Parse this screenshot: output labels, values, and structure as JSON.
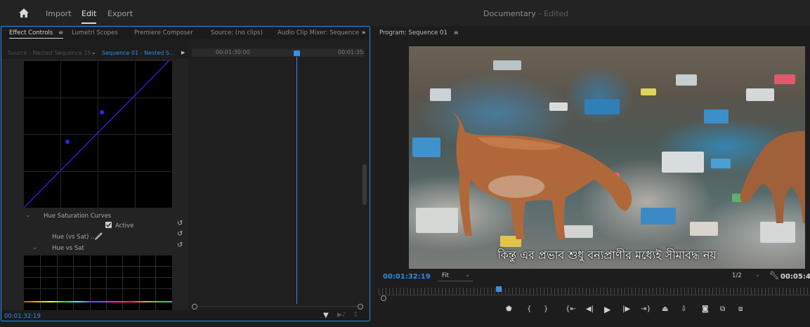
{
  "topbar": {
    "nav": [
      "Import",
      "Edit",
      "Export"
    ],
    "active_nav": "Edit",
    "doc_title": "Documentary",
    "doc_status": "- Edited"
  },
  "left_panel": {
    "tabs": [
      "Effect Controls",
      "Lumetri Scopes",
      "Premiere Composer",
      "Source: (no clips)",
      "Audio Clip Mixer: Sequence"
    ],
    "active_tab": "Effect Controls",
    "source_label": "Source - Nested Sequence 15",
    "sequence_select": "Sequence 01 - Nested S...",
    "ruler_times": [
      "00:01:30:00",
      "00:01:35:"
    ],
    "sections": {
      "hue_sat_curves": "Hue Saturation Curves",
      "active_label": "Active",
      "hue_vs_sat_short": "Hue (vs Sat) ...",
      "hue_vs_sat": "Hue vs Sat"
    },
    "timecode": "00:01:32:19"
  },
  "program": {
    "label": "Program: Sequence 01",
    "subtitle": "কিন্তু এর প্রভাব শুধু বন্যপ্রাণীর মধ্যেই সীমাবদ্ধ নয়",
    "timecode": "00:01:32:19",
    "fit": "Fit",
    "resolution": "1/2",
    "duration": "00:05:4"
  },
  "colors": {
    "accent": "#2d8ceb",
    "panel_border": "#2d8ceb",
    "background": "#1d1d1d"
  },
  "icons": {
    "home": "home-icon",
    "menu": "hamburger-icon",
    "overflow": "double-chevron-icon",
    "wrench": "wrench-icon",
    "transport": [
      "add-marker-icon",
      "mark-in-icon",
      "mark-out-icon",
      "go-to-in-icon",
      "step-back-icon",
      "play-icon",
      "step-forward-icon",
      "go-to-out-icon",
      "lift-icon",
      "extract-icon",
      "export-frame-icon",
      "compare-icon",
      "multi-camera-icon"
    ]
  }
}
